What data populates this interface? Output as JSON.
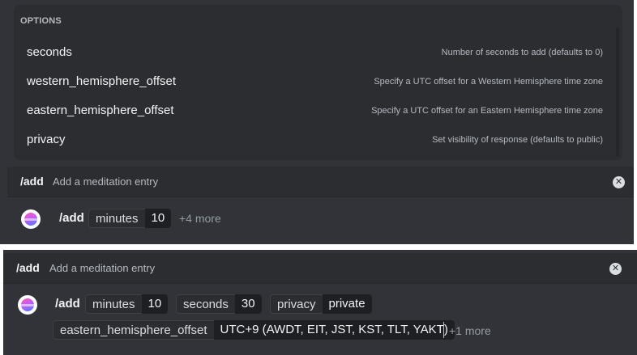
{
  "options": {
    "header": "OPTIONS",
    "items": [
      {
        "name": "seconds",
        "description": "Number of seconds to add (defaults to 0)"
      },
      {
        "name": "western_hemisphere_offset",
        "description": "Specify a UTC offset for a Western Hemisphere time zone"
      },
      {
        "name": "eastern_hemisphere_offset",
        "description": "Specify a UTC offset for an Eastern Hemisphere time zone"
      },
      {
        "name": "privacy",
        "description": "Set visibility of response (defaults to public)"
      }
    ]
  },
  "top": {
    "command": "/add",
    "command_description": "Add a meditation entry",
    "input": {
      "command": "/add",
      "params": [
        {
          "key": "minutes",
          "value": "10"
        }
      ],
      "more": "+4 more"
    }
  },
  "bottom": {
    "command": "/add",
    "command_description": "Add a meditation entry",
    "input": {
      "command": "/add",
      "params": [
        {
          "key": "minutes",
          "value": "10"
        },
        {
          "key": "seconds",
          "value": "30"
        },
        {
          "key": "privacy",
          "value": "private"
        },
        {
          "key": "eastern_hemisphere_offset",
          "value": "UTC+9 (AWDT, EIT, JST, KST, TLT, YAKT)"
        }
      ],
      "more": "+1 more"
    }
  },
  "colors": {
    "background": "#313338",
    "options_bg": "#2b2d31",
    "value_bg": "#1e1f22"
  }
}
